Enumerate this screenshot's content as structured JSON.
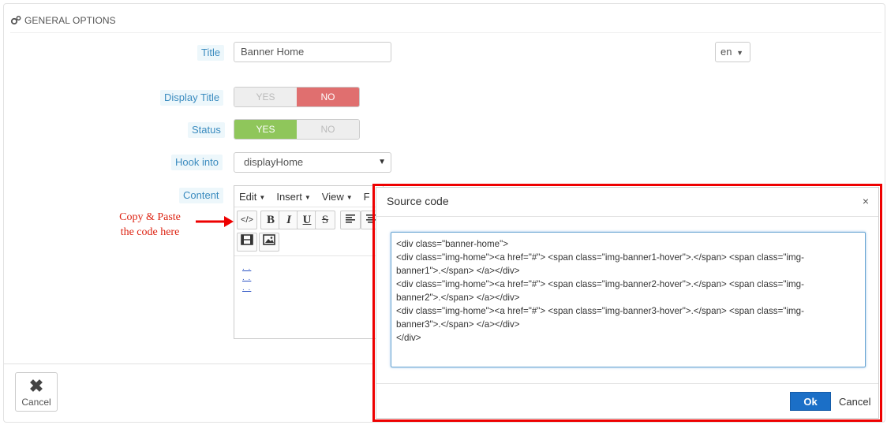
{
  "panel": {
    "heading": "GENERAL OPTIONS"
  },
  "form": {
    "title": {
      "label": "Title",
      "value": "Banner Home",
      "lang": "en"
    },
    "display_title": {
      "label": "Display Title",
      "yes": "YES",
      "no": "NO",
      "selected": "NO"
    },
    "status": {
      "label": "Status",
      "yes": "YES",
      "no": "NO",
      "selected": "YES"
    },
    "hook": {
      "label": "Hook into",
      "value": "displayHome"
    },
    "content": {
      "label": "Content"
    }
  },
  "editor": {
    "menu": [
      "Edit",
      "Insert",
      "View",
      "F"
    ],
    "toolbar": {
      "source": "</>",
      "bold": "B",
      "italic": "I",
      "underline": "U",
      "strike": "S"
    },
    "body_links": [
      ". .",
      ". .",
      ". ."
    ]
  },
  "annotation": {
    "line1": "Copy & Paste",
    "line2": "the code here",
    "color": "#dd2211"
  },
  "footer": {
    "cancel_label": "Cancel"
  },
  "modal": {
    "title": "Source code",
    "close": "×",
    "code_lines": [
      "<div class=\"banner-home\">",
      "<div class=\"img-home\"><a href=\"#\"> <span class=\"img-banner1-hover\">.</span> <span class=\"img-",
      "banner1\">.</span> </a></div>",
      "<div class=\"img-home\"><a href=\"#\"> <span class=\"img-banner2-hover\">.</span> <span class=\"img-",
      "banner2\">.</span> </a></div>",
      "<div class=\"img-home\"><a href=\"#\"> <span class=\"img-banner3-hover\">.</span> <span class=\"img-",
      "banner3\">.</span> </a></div>",
      "</div>"
    ],
    "ok_label": "Ok",
    "cancel_label": "Cancel",
    "highlight_color": "#ee0000",
    "ok_color": "#1b6fc7"
  }
}
